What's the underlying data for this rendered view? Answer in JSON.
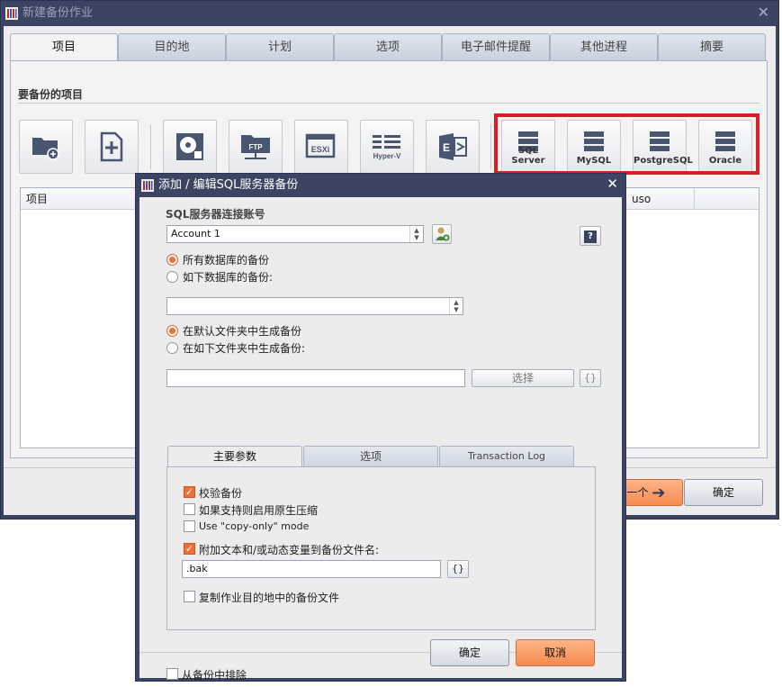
{
  "main_window": {
    "title": "新建备份作业",
    "tabs": [
      "项目",
      "目的地",
      "计划",
      "选项",
      "电子邮件提醒",
      "其他进程",
      "摘要"
    ],
    "section_label": "要备份的项目",
    "db_buttons": [
      "SQL Server",
      "MySQL",
      "PostgreSQL",
      "Oracle"
    ],
    "table_headers": [
      "项目",
      "uso",
      ""
    ],
    "next_label": "一个",
    "ok_label": "确定"
  },
  "dialog": {
    "title": "添加 / 编辑SQL服务器备份",
    "account_label": "SQL服务器连接账号",
    "account_value": "Account 1",
    "help_glyph": "?",
    "db_mode_all": "所有数据库的备份",
    "db_mode_selected": "如下数据库的备份:",
    "folder_default": "在默认文件夹中生成备份",
    "folder_custom": "在如下文件夹中生成备份:",
    "choose_label": "选择",
    "var_glyph": "{}",
    "inner_tabs": [
      "主要参数",
      "选项",
      "Transaction Log"
    ],
    "verify_label": "校验备份",
    "compress_label": "如果支持则启用原生压缩",
    "copy_only_label": "Use \"copy-only\" mode",
    "append_label": "附加文本和/或动态变量到备份文件名:",
    "append_value": ".bak",
    "copy_dest_label": "复制作业目的地中的备份文件",
    "exclude_label": "从备份中排除",
    "ok_label": "确定",
    "cancel_label": "取消"
  }
}
